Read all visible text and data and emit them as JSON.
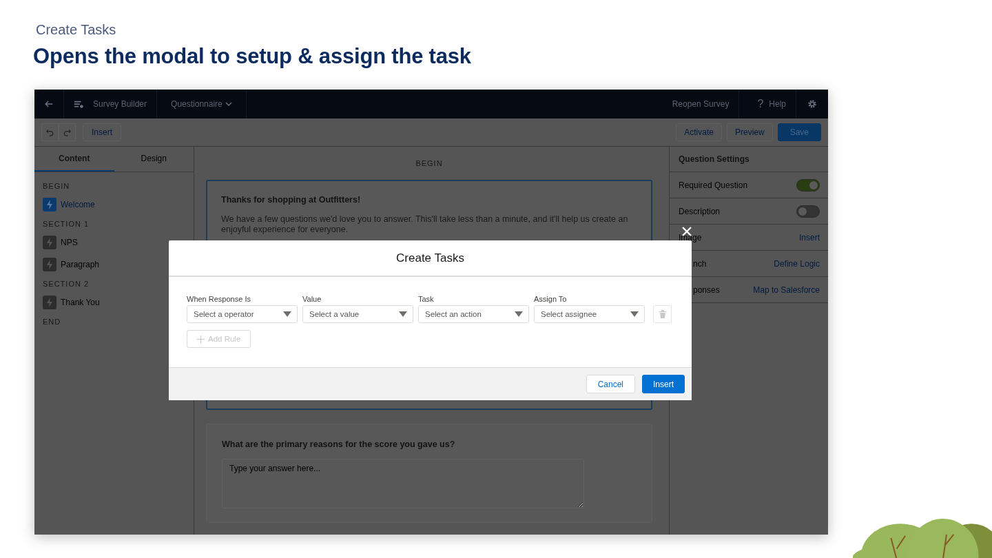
{
  "slide": {
    "subtitle": "Create Tasks",
    "title": "Opens the modal to setup & assign the task"
  },
  "nav": {
    "app_name": "Survey  Builder",
    "menu": "Questionnaire",
    "right_link": "Reopen Survey",
    "help_icon": "?",
    "help": "Help"
  },
  "toolbar": {
    "insert": "Insert",
    "actions": [
      {
        "label": "Activate",
        "kind": "neutral"
      },
      {
        "label": "Preview",
        "kind": "neutral"
      },
      {
        "label": "Save",
        "kind": "brand"
      }
    ]
  },
  "sidebar": {
    "tabs": [
      {
        "label": "Content",
        "selected": true
      },
      {
        "label": "Design",
        "selected": false
      }
    ],
    "outline": [
      {
        "label": "BEGIN",
        "children": [
          {
            "label": "Welcome",
            "selected": true
          }
        ]
      },
      {
        "label": "SECTION 1",
        "children": [
          {
            "label": "NPS",
            "selected": false
          },
          {
            "label": "Paragraph",
            "selected": false
          }
        ]
      },
      {
        "label": "SECTION 2",
        "children": [
          {
            "label": "Thank You",
            "selected": false
          }
        ]
      },
      {
        "label": "END"
      }
    ]
  },
  "canvas": {
    "section": "BEGIN",
    "welcome": {
      "title": "Thanks for shopping at Outfitters!",
      "body": "We have a few questions we'd love you to answer. This'll take less than a minute, and it'll help us create an enjoyful experience for everyone."
    },
    "question": {
      "title": "What are the primary reasons for the score you gave us?",
      "placeholder": "Type your answer here..."
    }
  },
  "settings": {
    "title": "Question Settings",
    "rows": [
      {
        "kind": "toggle",
        "label": "Required Question",
        "on": true
      },
      {
        "kind": "toggle",
        "label": "Description",
        "on": false
      },
      {
        "kind": "link",
        "label": "Image",
        "link": "Insert"
      },
      {
        "kind": "link",
        "label": "nch",
        "link": "Define Logic"
      },
      {
        "kind": "link",
        "label": "ponses",
        "link": "Map to Salesforce"
      }
    ]
  },
  "modal": {
    "title": "Create Tasks",
    "fields": [
      {
        "label": "When Response Is",
        "placeholder": "Select a operator"
      },
      {
        "label": "Value",
        "placeholder": "Select a value"
      },
      {
        "label": "Task",
        "placeholder": "Select an action"
      },
      {
        "label": "Assign To",
        "placeholder": "Select assignee"
      }
    ],
    "add_rule": {
      "label": "Add Rule",
      "disabled": true
    },
    "buttons": [
      {
        "label": "Cancel",
        "kind": "neutral"
      },
      {
        "label": "Insert",
        "kind": "brand"
      }
    ]
  }
}
